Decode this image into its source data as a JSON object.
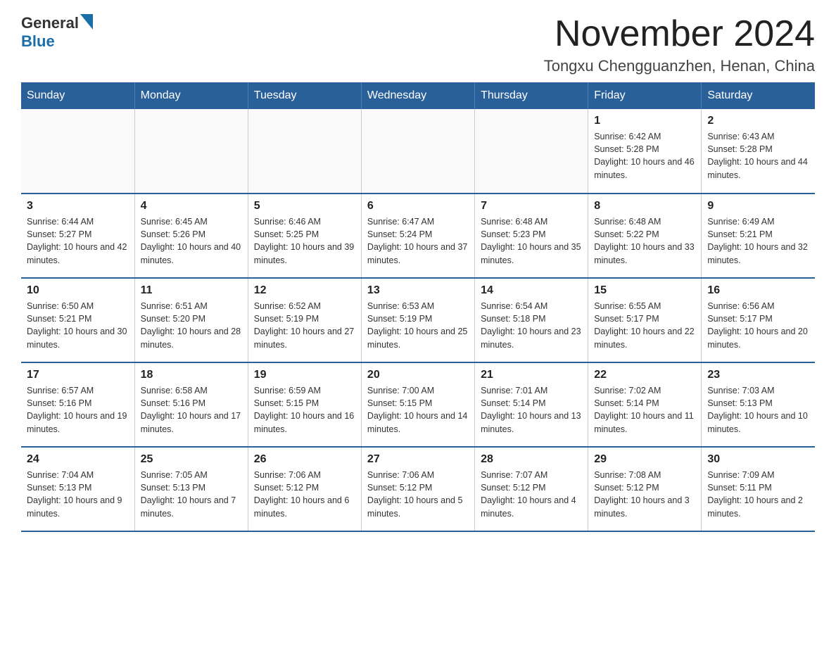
{
  "header": {
    "logo_general": "General",
    "logo_blue": "Blue",
    "month_title": "November 2024",
    "location": "Tongxu Chengguanzhen, Henan, China"
  },
  "weekdays": [
    "Sunday",
    "Monday",
    "Tuesday",
    "Wednesday",
    "Thursday",
    "Friday",
    "Saturday"
  ],
  "weeks": [
    [
      {
        "day": "",
        "info": ""
      },
      {
        "day": "",
        "info": ""
      },
      {
        "day": "",
        "info": ""
      },
      {
        "day": "",
        "info": ""
      },
      {
        "day": "",
        "info": ""
      },
      {
        "day": "1",
        "info": "Sunrise: 6:42 AM\nSunset: 5:28 PM\nDaylight: 10 hours and 46 minutes."
      },
      {
        "day": "2",
        "info": "Sunrise: 6:43 AM\nSunset: 5:28 PM\nDaylight: 10 hours and 44 minutes."
      }
    ],
    [
      {
        "day": "3",
        "info": "Sunrise: 6:44 AM\nSunset: 5:27 PM\nDaylight: 10 hours and 42 minutes."
      },
      {
        "day": "4",
        "info": "Sunrise: 6:45 AM\nSunset: 5:26 PM\nDaylight: 10 hours and 40 minutes."
      },
      {
        "day": "5",
        "info": "Sunrise: 6:46 AM\nSunset: 5:25 PM\nDaylight: 10 hours and 39 minutes."
      },
      {
        "day": "6",
        "info": "Sunrise: 6:47 AM\nSunset: 5:24 PM\nDaylight: 10 hours and 37 minutes."
      },
      {
        "day": "7",
        "info": "Sunrise: 6:48 AM\nSunset: 5:23 PM\nDaylight: 10 hours and 35 minutes."
      },
      {
        "day": "8",
        "info": "Sunrise: 6:48 AM\nSunset: 5:22 PM\nDaylight: 10 hours and 33 minutes."
      },
      {
        "day": "9",
        "info": "Sunrise: 6:49 AM\nSunset: 5:21 PM\nDaylight: 10 hours and 32 minutes."
      }
    ],
    [
      {
        "day": "10",
        "info": "Sunrise: 6:50 AM\nSunset: 5:21 PM\nDaylight: 10 hours and 30 minutes."
      },
      {
        "day": "11",
        "info": "Sunrise: 6:51 AM\nSunset: 5:20 PM\nDaylight: 10 hours and 28 minutes."
      },
      {
        "day": "12",
        "info": "Sunrise: 6:52 AM\nSunset: 5:19 PM\nDaylight: 10 hours and 27 minutes."
      },
      {
        "day": "13",
        "info": "Sunrise: 6:53 AM\nSunset: 5:19 PM\nDaylight: 10 hours and 25 minutes."
      },
      {
        "day": "14",
        "info": "Sunrise: 6:54 AM\nSunset: 5:18 PM\nDaylight: 10 hours and 23 minutes."
      },
      {
        "day": "15",
        "info": "Sunrise: 6:55 AM\nSunset: 5:17 PM\nDaylight: 10 hours and 22 minutes."
      },
      {
        "day": "16",
        "info": "Sunrise: 6:56 AM\nSunset: 5:17 PM\nDaylight: 10 hours and 20 minutes."
      }
    ],
    [
      {
        "day": "17",
        "info": "Sunrise: 6:57 AM\nSunset: 5:16 PM\nDaylight: 10 hours and 19 minutes."
      },
      {
        "day": "18",
        "info": "Sunrise: 6:58 AM\nSunset: 5:16 PM\nDaylight: 10 hours and 17 minutes."
      },
      {
        "day": "19",
        "info": "Sunrise: 6:59 AM\nSunset: 5:15 PM\nDaylight: 10 hours and 16 minutes."
      },
      {
        "day": "20",
        "info": "Sunrise: 7:00 AM\nSunset: 5:15 PM\nDaylight: 10 hours and 14 minutes."
      },
      {
        "day": "21",
        "info": "Sunrise: 7:01 AM\nSunset: 5:14 PM\nDaylight: 10 hours and 13 minutes."
      },
      {
        "day": "22",
        "info": "Sunrise: 7:02 AM\nSunset: 5:14 PM\nDaylight: 10 hours and 11 minutes."
      },
      {
        "day": "23",
        "info": "Sunrise: 7:03 AM\nSunset: 5:13 PM\nDaylight: 10 hours and 10 minutes."
      }
    ],
    [
      {
        "day": "24",
        "info": "Sunrise: 7:04 AM\nSunset: 5:13 PM\nDaylight: 10 hours and 9 minutes."
      },
      {
        "day": "25",
        "info": "Sunrise: 7:05 AM\nSunset: 5:13 PM\nDaylight: 10 hours and 7 minutes."
      },
      {
        "day": "26",
        "info": "Sunrise: 7:06 AM\nSunset: 5:12 PM\nDaylight: 10 hours and 6 minutes."
      },
      {
        "day": "27",
        "info": "Sunrise: 7:06 AM\nSunset: 5:12 PM\nDaylight: 10 hours and 5 minutes."
      },
      {
        "day": "28",
        "info": "Sunrise: 7:07 AM\nSunset: 5:12 PM\nDaylight: 10 hours and 4 minutes."
      },
      {
        "day": "29",
        "info": "Sunrise: 7:08 AM\nSunset: 5:12 PM\nDaylight: 10 hours and 3 minutes."
      },
      {
        "day": "30",
        "info": "Sunrise: 7:09 AM\nSunset: 5:11 PM\nDaylight: 10 hours and 2 minutes."
      }
    ]
  ]
}
